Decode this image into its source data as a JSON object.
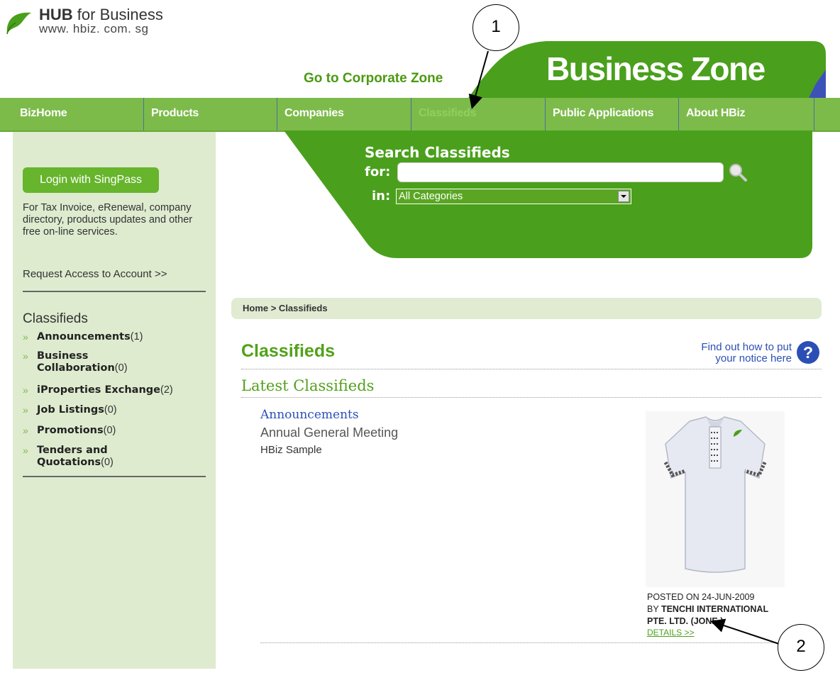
{
  "header": {
    "logo_brand": "HUB",
    "logo_suffix": "for Business",
    "logo_url": "www. hbiz. com. sg",
    "corporate_link": "Go to Corporate Zone",
    "zone_title": "Business Zone"
  },
  "nav": {
    "items": [
      {
        "label": "BizHome"
      },
      {
        "label": "Products"
      },
      {
        "label": "Companies"
      },
      {
        "label": "Classifieds"
      },
      {
        "label": "Public Applications"
      },
      {
        "label": "About HBiz"
      }
    ],
    "active": "Classifieds"
  },
  "sidebar": {
    "login_button": "Login with SingPass",
    "login_desc": "For Tax Invoice, eRenewal, company directory, products updates and other free on-line services.",
    "request_link": "Request Access to Account >>",
    "classifieds_heading": "Classifieds",
    "bullet": "»",
    "categories": [
      {
        "name": "Announcements",
        "count": "(1)"
      },
      {
        "name": "Business Collaboration",
        "count": "(0)"
      },
      {
        "name": "iProperties Exchange",
        "count": "(2)"
      },
      {
        "name": "Job Listings",
        "count": "(0)"
      },
      {
        "name": "Promotions",
        "count": "(0)"
      },
      {
        "name": "Tenders and Quotations",
        "count": "(0)"
      }
    ]
  },
  "search": {
    "title": "Search Classifieds",
    "for_label": "for:",
    "in_label": "in:",
    "query": "",
    "category_selected": "All Categories"
  },
  "breadcrumb": "Home > Classifieds",
  "main": {
    "title": "Classifieds",
    "help_line1": "Find out how to put",
    "help_line2": "your notice here",
    "latest_heading": "Latest Classifieds",
    "item": {
      "category": "Announcements",
      "title": "Annual General Meeting",
      "subtitle": "HBiz Sample",
      "posted_on": "POSTED ON 24-JUN-2009",
      "by_prefix": "BY",
      "by_company_line1": "TENCHI INTERNATIONAL",
      "by_company_line2": "PTE. LTD. (JONE )",
      "details_link": "DETAILS >>"
    }
  },
  "callouts": [
    "1",
    "2"
  ],
  "colors": {
    "brand_green": "#66b52c",
    "nav_green": "#7cbb4a",
    "sidebar_bg": "#deebcf",
    "link_blue": "#2b4fb5"
  }
}
